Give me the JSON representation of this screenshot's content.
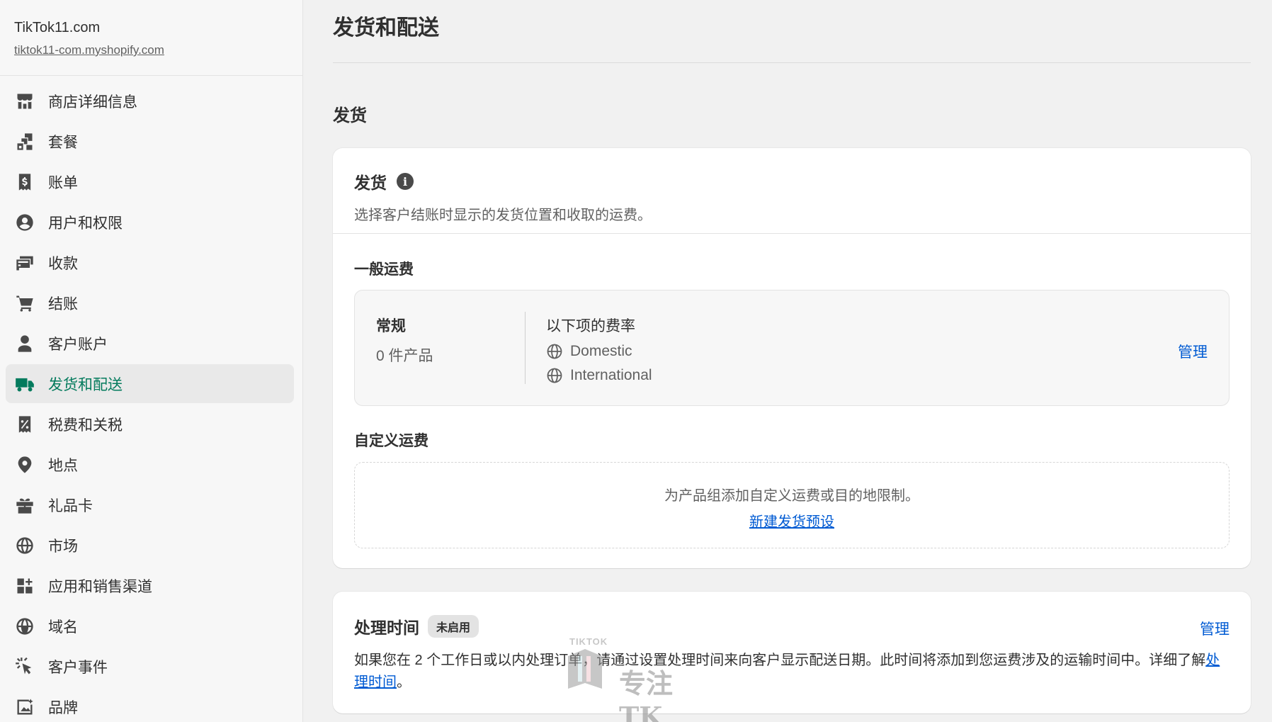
{
  "store": {
    "name": "TikTok11.com",
    "url": "tiktok11-com.myshopify.com"
  },
  "sidebar": {
    "items": [
      {
        "label": "商店详细信息",
        "icon": "store-icon"
      },
      {
        "label": "套餐",
        "icon": "plan-icon"
      },
      {
        "label": "账单",
        "icon": "billing-icon"
      },
      {
        "label": "用户和权限",
        "icon": "user-circle-icon"
      },
      {
        "label": "收款",
        "icon": "payments-icon"
      },
      {
        "label": "结账",
        "icon": "cart-icon"
      },
      {
        "label": "客户账户",
        "icon": "person-icon"
      },
      {
        "label": "发货和配送",
        "icon": "truck-icon",
        "active": true
      },
      {
        "label": "税费和关税",
        "icon": "tax-icon"
      },
      {
        "label": "地点",
        "icon": "location-pin-icon"
      },
      {
        "label": "礼品卡",
        "icon": "gift-icon"
      },
      {
        "label": "市场",
        "icon": "globe-icon"
      },
      {
        "label": "应用和销售渠道",
        "icon": "apps-icon"
      },
      {
        "label": "域名",
        "icon": "domain-globe-icon"
      },
      {
        "label": "客户事件",
        "icon": "cursor-click-icon"
      },
      {
        "label": "品牌",
        "icon": "brand-image-icon"
      }
    ]
  },
  "page": {
    "title": "发货和配送",
    "section_title": "发货"
  },
  "shipping_card": {
    "title": "发货",
    "subtitle": "选择客户结账时显示的发货位置和收取的运费。",
    "general_heading": "一般运费",
    "profile": {
      "name": "常规",
      "count": "0 件产品",
      "rates_label": "以下项的费率",
      "zones": [
        "Domestic",
        "International"
      ],
      "manage_label": "管理"
    },
    "custom_heading": "自定义运费",
    "custom_text": "为产品组添加自定义运费或目的地限制。",
    "custom_link": "新建发货预设"
  },
  "processing_card": {
    "title": "处理时间",
    "badge": "未启用",
    "manage_label": "管理",
    "body_text": "如果您在 2 个工作日或以内处理订单，请通过设置处理时间来向客户显示配送日期。此时间将添加到您运费涉及的运输时间中。详细了解",
    "body_link": "处理时间",
    "body_end": "。"
  },
  "watermark": {
    "top": "TIKTOK",
    "text": "专注TK"
  },
  "colors": {
    "accent_green": "#047b5d",
    "link_blue": "#005bd3",
    "sidebar_bg": "#f7f7f7",
    "page_bg": "#f1f1f1"
  }
}
